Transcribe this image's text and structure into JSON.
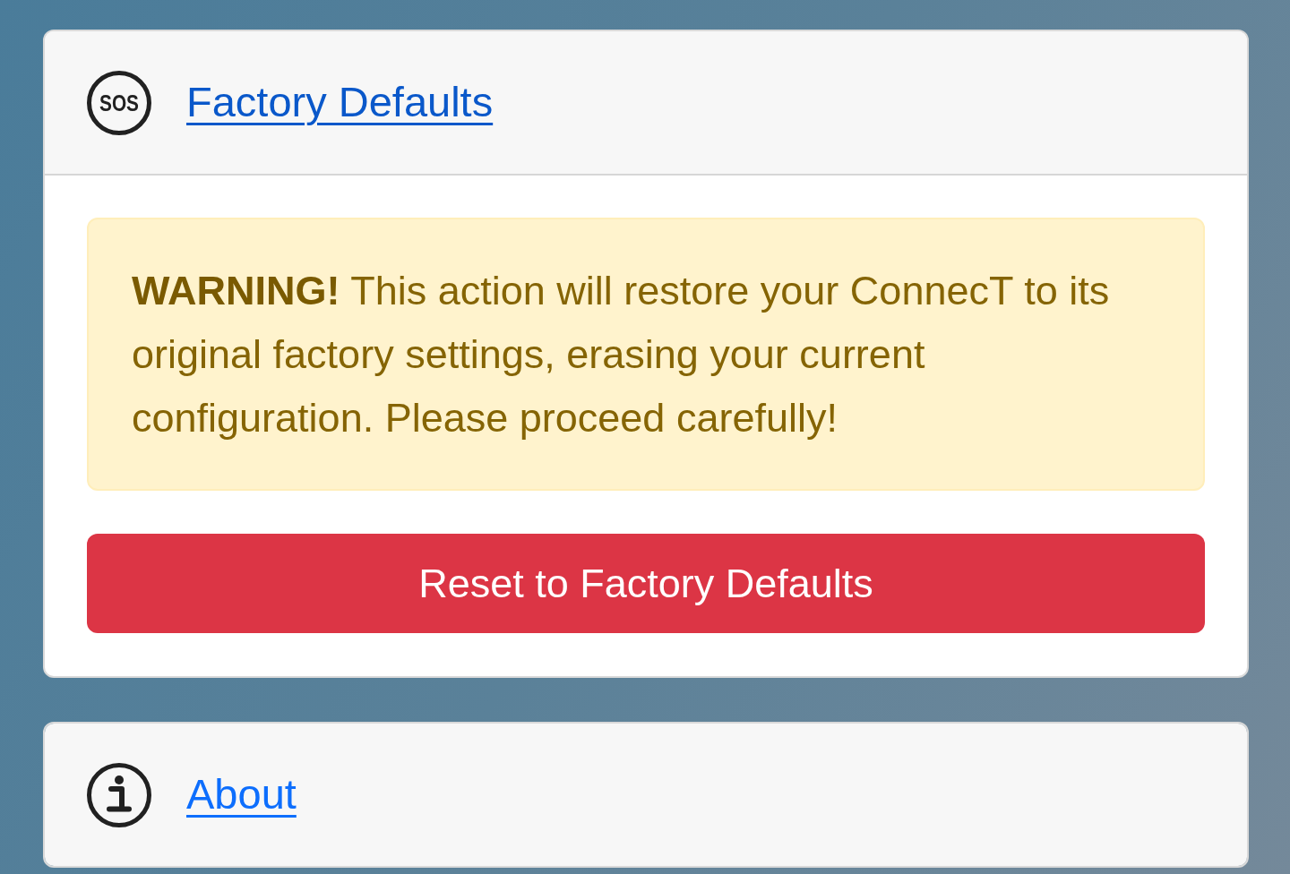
{
  "sections": [
    {
      "kind": "sos",
      "icon_text": "SOS",
      "title": "Factory Defaults",
      "expanded": true,
      "alert": {
        "text": "**WARNING!** This action will restore your ConnecT to its original factory settings, erasing your current configuration. Please proceed carefully!"
      },
      "button": {
        "label": "Reset to Factory Defaults"
      }
    },
    {
      "kind": "info",
      "title": "About",
      "expanded": false
    }
  ]
}
